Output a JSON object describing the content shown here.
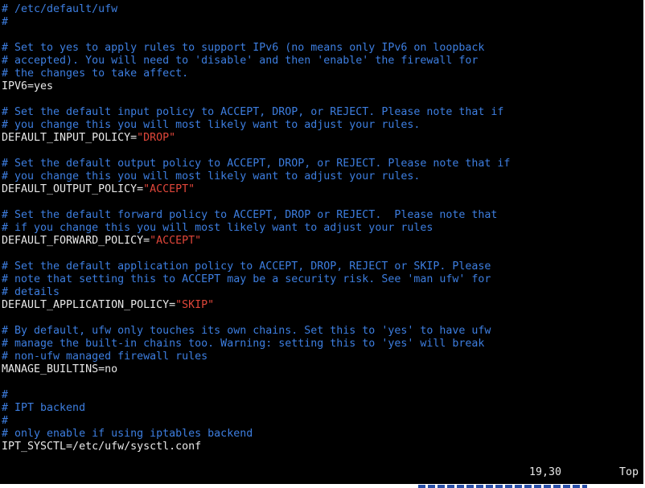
{
  "editor": {
    "lines": [
      [
        {
          "text": "# /etc/default/ufw",
          "style": "c"
        }
      ],
      [
        {
          "text": "#",
          "style": "c"
        }
      ],
      [],
      [
        {
          "text": "# Set to yes to apply rules to support IPv6 (no means only IPv6 on loopback",
          "style": "c"
        }
      ],
      [
        {
          "text": "# accepted). You will need to 'disable' and then 'enable' the firewall for",
          "style": "c"
        }
      ],
      [
        {
          "text": "# the changes to take affect.",
          "style": "c"
        }
      ],
      [
        {
          "text": "IPV6=yes",
          "style": "t"
        }
      ],
      [],
      [
        {
          "text": "# Set the default input policy to ACCEPT, DROP, or REJECT. Please note that if",
          "style": "c"
        }
      ],
      [
        {
          "text": "# you change this you will most likely want to adjust your rules.",
          "style": "c"
        }
      ],
      [
        {
          "text": "DEFAULT_INPUT_POLICY=",
          "style": "t"
        },
        {
          "text": "\"DROP\"",
          "style": "s"
        }
      ],
      [],
      [
        {
          "text": "# Set the default output policy to ACCEPT, DROP, or REJECT. Please note that if",
          "style": "c"
        }
      ],
      [
        {
          "text": "# you change this you will most likely want to adjust your rules.",
          "style": "c"
        }
      ],
      [
        {
          "text": "DEFAULT_OUTPUT_POLICY=",
          "style": "t"
        },
        {
          "text": "\"ACCEPT\"",
          "style": "s"
        }
      ],
      [],
      [
        {
          "text": "# Set the default forward policy to ACCEPT, DROP or REJECT.  Please note that",
          "style": "c"
        }
      ],
      [
        {
          "text": "# if you change this you will most likely want to adjust your rules",
          "style": "c"
        }
      ],
      [
        {
          "text": "DEFAULT_FORWARD_POLICY=",
          "style": "t"
        },
        {
          "text": "\"ACCEPT\"",
          "style": "s"
        }
      ],
      [],
      [
        {
          "text": "# Set the default application policy to ACCEPT, DROP, REJECT or SKIP. Please",
          "style": "c"
        }
      ],
      [
        {
          "text": "# note that setting this to ACCEPT may be a security risk. See 'man ufw' for",
          "style": "c"
        }
      ],
      [
        {
          "text": "# details",
          "style": "c"
        }
      ],
      [
        {
          "text": "DEFAULT_APPLICATION_POLICY=",
          "style": "t"
        },
        {
          "text": "\"SKIP\"",
          "style": "s"
        }
      ],
      [],
      [
        {
          "text": "# By default, ufw only touches its own chains. Set this to 'yes' to have ufw",
          "style": "c"
        }
      ],
      [
        {
          "text": "# manage the built-in chains too. Warning: setting this to 'yes' will break",
          "style": "c"
        }
      ],
      [
        {
          "text": "# non-ufw managed firewall rules",
          "style": "c"
        }
      ],
      [
        {
          "text": "MANAGE_BUILTINS=no",
          "style": "t"
        }
      ],
      [],
      [
        {
          "text": "#",
          "style": "c"
        }
      ],
      [
        {
          "text": "# IPT backend",
          "style": "c"
        }
      ],
      [
        {
          "text": "#",
          "style": "c"
        }
      ],
      [
        {
          "text": "# only enable if using iptables backend",
          "style": "c"
        }
      ],
      [
        {
          "text": "IPT_SYSCTL=/etc/ufw/sysctl.conf",
          "style": "t"
        }
      ]
    ]
  },
  "status": {
    "cursor_position": "19,30",
    "scroll_position": "Top"
  },
  "colors": {
    "background": "#000000",
    "comment": "#3d7ee0",
    "string": "#e0463a",
    "text": "#e8e8e8"
  }
}
